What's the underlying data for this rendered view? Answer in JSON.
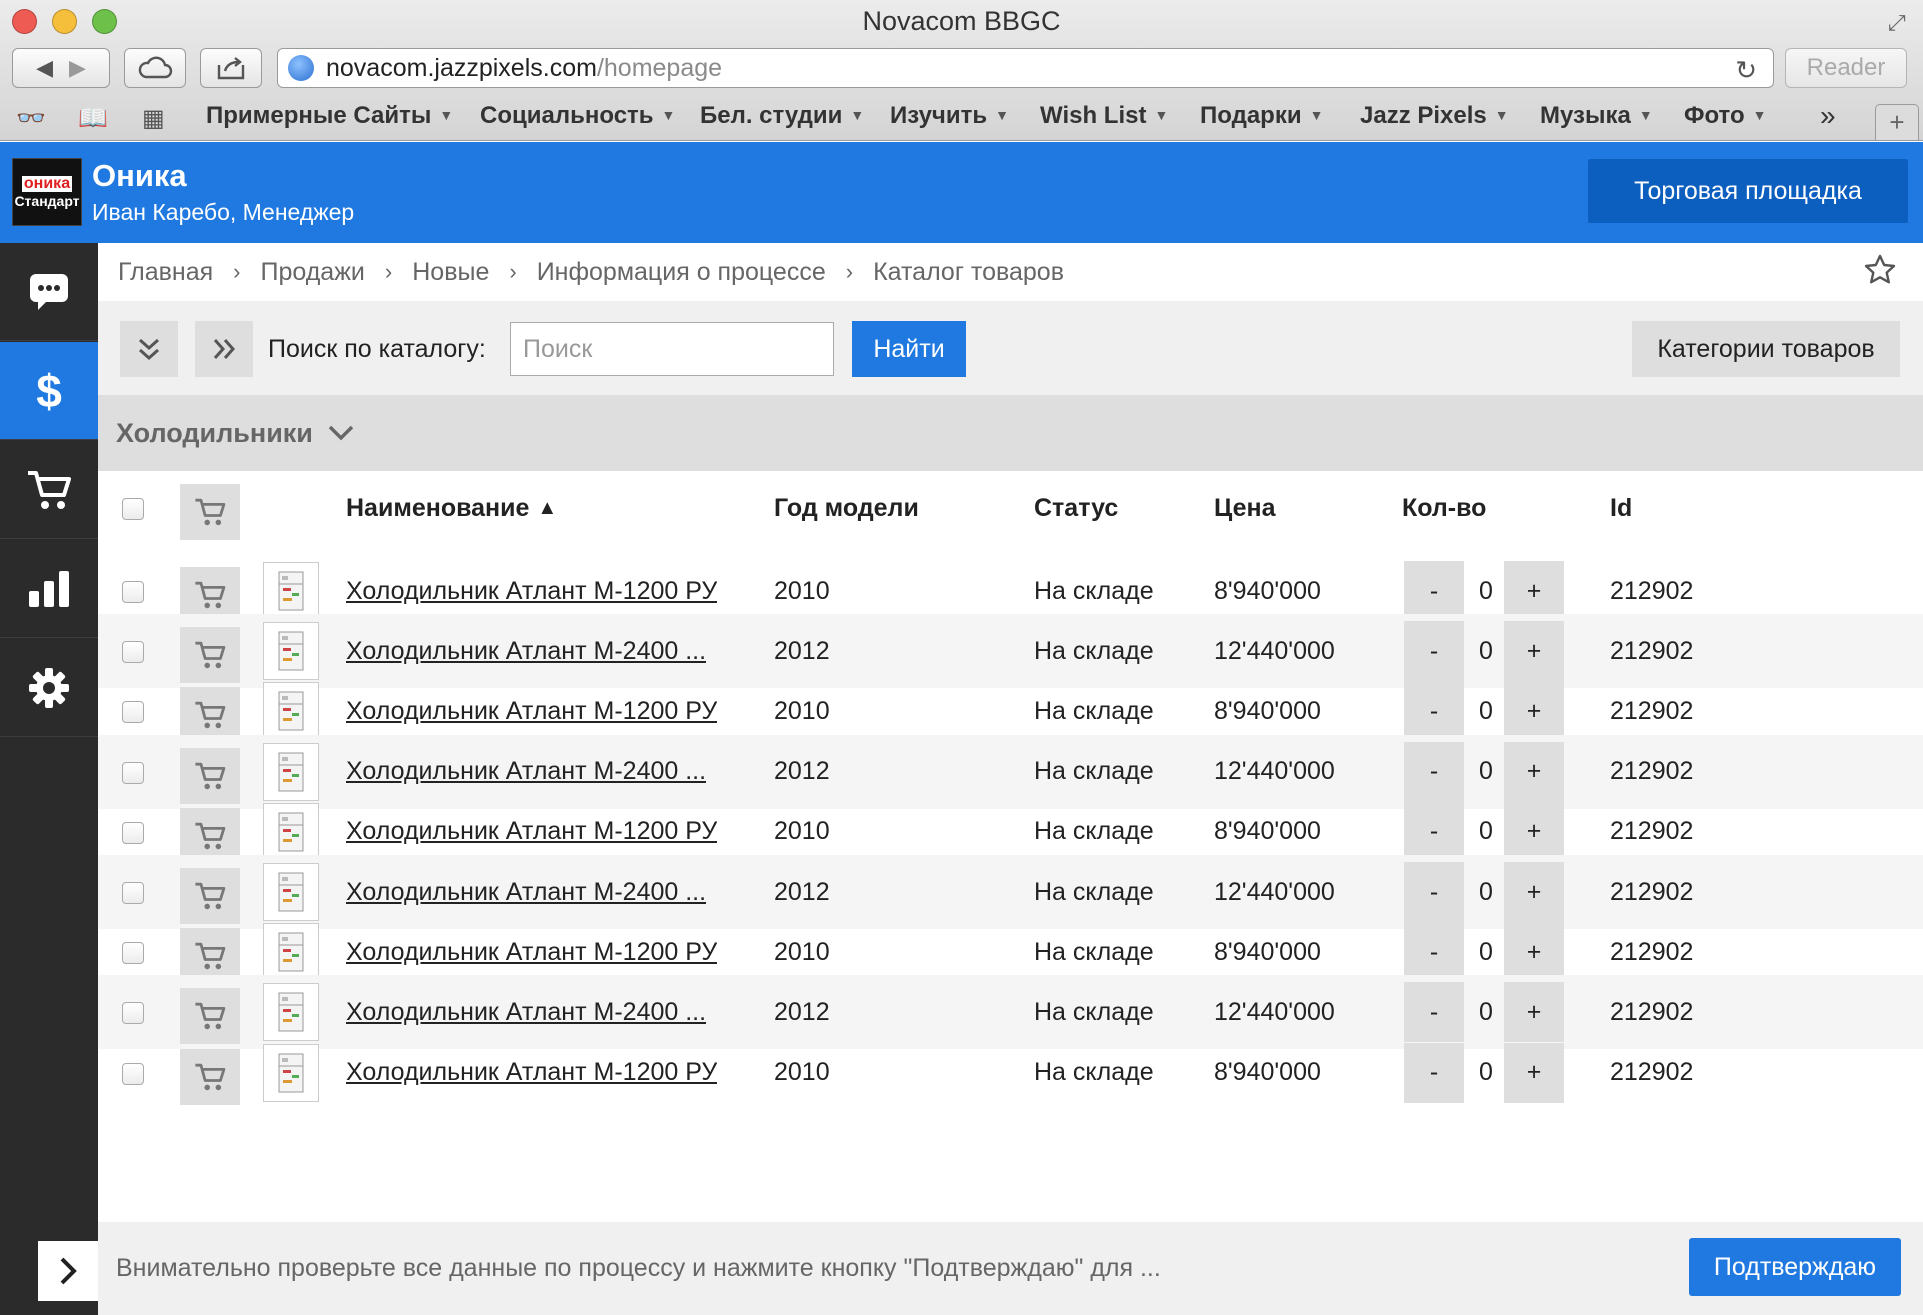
{
  "browser": {
    "window_title": "Novacom BBGC",
    "url_host": "novacom.jazzpixels.com",
    "url_path": "/homepage",
    "reader_label": "Reader",
    "bookmarks": [
      "Примерные Сайты",
      "Социальность",
      "Бел. студии",
      "Изучить",
      "Wish List",
      "Подарки",
      "Jazz Pixels",
      "Музыка",
      "Фото"
    ]
  },
  "header": {
    "logo_line1": "оника",
    "logo_line2": "Стандарт",
    "app_name": "Оника",
    "user": "Иван Каребо, Менеджер",
    "marketplace_button": "Торговая площадка"
  },
  "sidebar": {
    "items": [
      {
        "icon": "chat-icon",
        "active": false
      },
      {
        "icon": "dollar-icon",
        "active": true
      },
      {
        "icon": "cart-icon",
        "active": false
      },
      {
        "icon": "bar-chart-icon",
        "active": false
      },
      {
        "icon": "gear-icon",
        "active": false
      }
    ]
  },
  "breadcrumb": [
    "Главная",
    "Продажи",
    "Новые",
    "Информация о процессе",
    "Каталог товаров"
  ],
  "toolbar": {
    "search_label": "Поиск по каталогу:",
    "search_placeholder": "Поиск",
    "search_value": "",
    "search_button": "Найти",
    "categories_button": "Категории товаров"
  },
  "group": {
    "title": "Холодильники"
  },
  "table": {
    "headers": {
      "name": "Наименование",
      "sort_indicator": "▲",
      "year": "Год модели",
      "status": "Статус",
      "price": "Цена",
      "qty": "Кол-во",
      "id": "Id"
    },
    "qty_minus": "-",
    "qty_plus": "+",
    "rows": [
      {
        "name": "Холодильник Атлант М-1200 РУ",
        "year": "2010",
        "status": "На складе",
        "price": "8'940'000",
        "qty": "0",
        "id": "212902"
      },
      {
        "name": "Холодильник Атлант М-2400 ...",
        "year": "2012",
        "status": "На складе",
        "price": "12'440'000",
        "qty": "0",
        "id": "212902"
      },
      {
        "name": "Холодильник Атлант М-1200 РУ",
        "year": "2010",
        "status": "На складе",
        "price": "8'940'000",
        "qty": "0",
        "id": "212902"
      },
      {
        "name": "Холодильник Атлант М-2400 ...",
        "year": "2012",
        "status": "На складе",
        "price": "12'440'000",
        "qty": "0",
        "id": "212902"
      },
      {
        "name": "Холодильник Атлант М-1200 РУ",
        "year": "2010",
        "status": "На складе",
        "price": "8'940'000",
        "qty": "0",
        "id": "212902"
      },
      {
        "name": "Холодильник Атлант М-2400 ...",
        "year": "2012",
        "status": "На складе",
        "price": "12'440'000",
        "qty": "0",
        "id": "212902"
      },
      {
        "name": "Холодильник Атлант М-1200 РУ",
        "year": "2010",
        "status": "На складе",
        "price": "8'940'000",
        "qty": "0",
        "id": "212902"
      },
      {
        "name": "Холодильник Атлант М-2400 ...",
        "year": "2012",
        "status": "На складе",
        "price": "12'440'000",
        "qty": "0",
        "id": "212902"
      },
      {
        "name": "Холодильник Атлант М-1200 РУ",
        "year": "2010",
        "status": "На складе",
        "price": "8'940'000",
        "qty": "0",
        "id": "212902"
      }
    ]
  },
  "footer": {
    "message": "Внимательно проверьте все данные по процессу и нажмите кнопку \"Подтверждаю\" для ...",
    "confirm_button": "Подтверждаю"
  },
  "colors": {
    "accent": "#1f79e0",
    "sidebar_bg": "#2b2b2b",
    "button_gray": "#dedede"
  }
}
